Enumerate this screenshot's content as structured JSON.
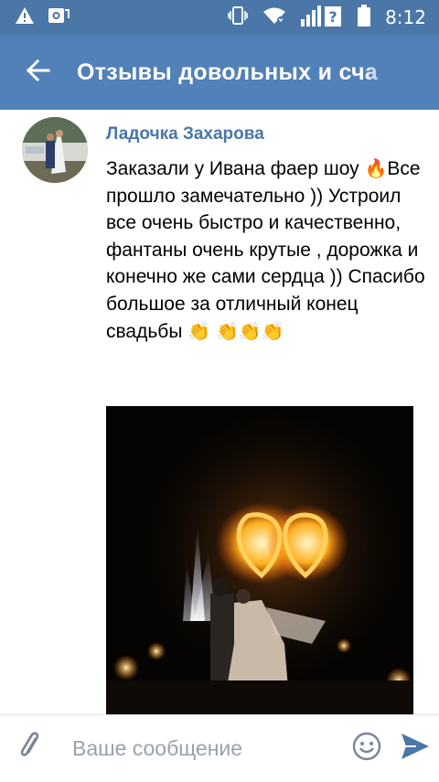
{
  "status_bar": {
    "time": "8:12",
    "icons": [
      "warning-icon",
      "gallery-sync-icon",
      "vibrate-icon",
      "wifi-icon",
      "signal-icon",
      "battery-icon"
    ],
    "background": "#4a76a8"
  },
  "toolbar": {
    "title": "Отзывы довольных и сча",
    "back_icon": "arrow-back-icon",
    "background": "#5181b8"
  },
  "message": {
    "author": "Ладочка Захарова",
    "author_color": "#4a76a8",
    "text_1": "Заказали у Ивана фаер шоу ",
    "text_2": "Все прошло замечательно )) Устроил все очень быстро и качественно, фантаны очень крутые , дорожка и конечно же сами сердца )) Спасибо большое за отличный конец свадьбы ",
    "emoji_fire": "🔥",
    "emoji_clap": "👏",
    "emoji_claps_line": [
      "👏",
      "👏",
      "👏"
    ],
    "avatar_icon": "wedding-couple-avatar",
    "photo_icon": "fire-hearts-show-photo"
  },
  "composer": {
    "placeholder": "Ваше сообщение",
    "attach_icon": "paperclip-icon",
    "smile_icon": "smile-icon",
    "send_icon": "send-icon",
    "accent": "#4a76a8"
  }
}
